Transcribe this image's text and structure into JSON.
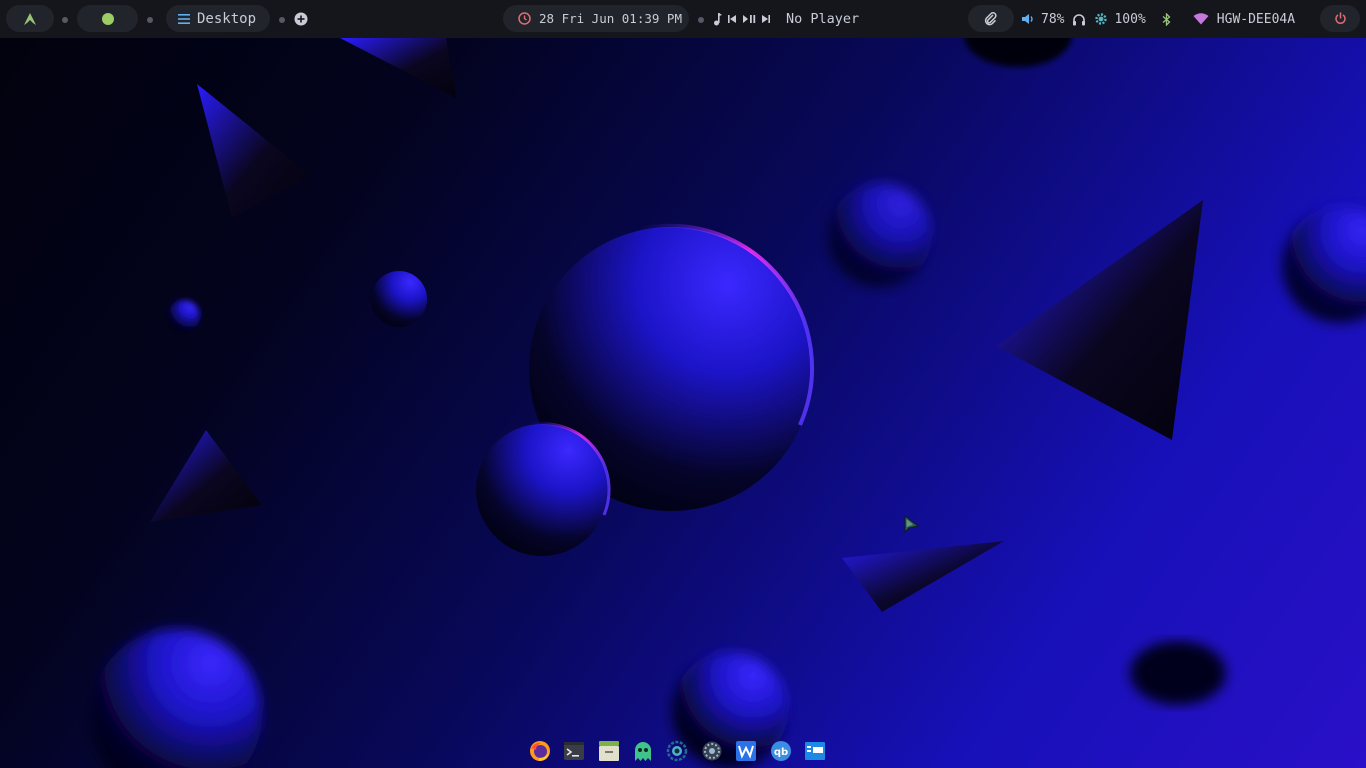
{
  "topbar": {
    "launcher_icon": "arch-logo-icon",
    "workspace_dot_color": "#9ccc65",
    "window_menu_icon": "hamburger-menu-icon",
    "window_title": "Desktop",
    "add_workspace_icon": "plus-circle-icon",
    "clock": {
      "icon": "clock-icon",
      "text": "28 Fri Jun 01:39 PM",
      "icon_color": "#e06c75"
    },
    "media": {
      "note_icon": "music-note-icon",
      "prev_icon": "skip-previous-icon",
      "playpause_icon": "play-pause-icon",
      "next_icon": "skip-next-icon",
      "player_text": "No Player"
    },
    "tray": {
      "clip_icon": "paperclip-icon",
      "volume_icon": "speaker-icon",
      "volume_text": "78%",
      "headphone_icon": "headphones-icon",
      "brightness_icon": "brightness-gear-icon",
      "brightness_text": "100%",
      "bluetooth_icon": "bluetooth-icon",
      "wifi_icon": "wifi-icon",
      "wifi_text": "HGW-DEE04A",
      "power_icon": "power-icon",
      "accent_blue": "#61afef",
      "accent_green": "#98c379",
      "accent_pink": "#c678dd",
      "accent_red": "#e06c75"
    }
  },
  "dock": {
    "items": [
      {
        "name": "firefox",
        "icon": "firefox-icon"
      },
      {
        "name": "terminal",
        "icon": "terminal-icon"
      },
      {
        "name": "file-manager",
        "icon": "folder-icon"
      },
      {
        "name": "ghost-app",
        "icon": "ghost-icon"
      },
      {
        "name": "settings",
        "icon": "circular-app-icon"
      },
      {
        "name": "system-tool",
        "icon": "gear-wheel-icon"
      },
      {
        "name": "wps-writer",
        "icon": "w-document-icon"
      },
      {
        "name": "qbittorrent",
        "icon": "qb-icon"
      },
      {
        "name": "window-app",
        "icon": "window-icon"
      }
    ]
  }
}
